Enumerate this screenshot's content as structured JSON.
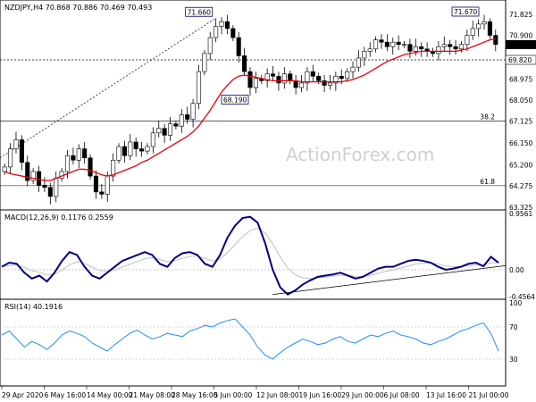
{
  "colors": {
    "background": "#ffffff",
    "candle_up": "#000000",
    "candle_down": "#000000",
    "sma": "#e8000b",
    "macd_main": "#000080",
    "macd_signal": "#c0c0c0",
    "rsi": "#1e90ff",
    "level_line": "#000000",
    "price_tag_bg": "#000000",
    "price_tag_text": "#ffffff",
    "rsi_level": "#aaaaaa"
  },
  "chart_data": [
    {
      "type": "candlestick",
      "title": "NZDJPY,H4  70.868 70.886 70.469 70.493",
      "ylim": [
        63.325,
        72.3
      ],
      "yticks": [
        "71.825",
        "70.900",
        "69.820",
        "68.975",
        "68.050",
        "67.125",
        "66.150",
        "65.200",
        "64.275",
        "63.325"
      ],
      "current_price": "70.493",
      "level_price": "69.820",
      "close": [
        65.1,
        65.9,
        66.3,
        65.3,
        64.5,
        64.9,
        64.3,
        64.2,
        63.8,
        64.6,
        64.9,
        65.6,
        65.4,
        65.9,
        65.5,
        64.7,
        64.0,
        63.9,
        64.7,
        65.4,
        66.0,
        65.6,
        66.2,
        65.9,
        65.8,
        66.0,
        66.6,
        66.8,
        66.5,
        67.0,
        66.9,
        67.4,
        67.2,
        67.9,
        69.3,
        70.1,
        70.8,
        71.3,
        71.5,
        71.2,
        70.8,
        70.0,
        69.3,
        68.6,
        69.0,
        68.9,
        69.2,
        69.1,
        68.8,
        69.2,
        68.9,
        68.6,
        68.8,
        69.3,
        69.1,
        68.9,
        68.7,
        68.8,
        69.1,
        69.0,
        69.3,
        69.5,
        69.9,
        70.2,
        70.3,
        70.7,
        70.6,
        70.4,
        70.6,
        70.5,
        70.5,
        70.2,
        70.4,
        70.3,
        70.2,
        70.1,
        70.4,
        70.5,
        70.4,
        70.3,
        70.5,
        70.9,
        71.2,
        71.4,
        71.5,
        70.9,
        70.5
      ],
      "sma": [
        64.9,
        64.8,
        64.75,
        64.7,
        64.65,
        64.6,
        64.55,
        64.5,
        64.5,
        64.6,
        64.7,
        64.8,
        64.9,
        65.0,
        65.0,
        64.95,
        64.85,
        64.75,
        64.7,
        64.75,
        64.85,
        64.95,
        65.05,
        65.15,
        65.3,
        65.4,
        65.55,
        65.7,
        65.85,
        66.0,
        66.15,
        66.3,
        66.45,
        66.65,
        66.9,
        67.25,
        67.6,
        68.0,
        68.4,
        68.7,
        68.95,
        69.1,
        69.15,
        69.1,
        69.05,
        69.0,
        68.95,
        68.9,
        68.9,
        68.9,
        68.9,
        68.9,
        68.85,
        68.85,
        68.85,
        68.85,
        68.85,
        68.85,
        68.85,
        68.85,
        68.9,
        68.95,
        69.05,
        69.15,
        69.3,
        69.45,
        69.6,
        69.75,
        69.85,
        69.95,
        70.05,
        70.1,
        70.15,
        70.2,
        70.2,
        70.2,
        70.2,
        70.2,
        70.2,
        70.2,
        70.25,
        70.3,
        70.4,
        70.5,
        70.6,
        70.7,
        70.75
      ],
      "annotations": [
        {
          "text": "71.660",
          "price": 71.66
        },
        {
          "text": "68.190",
          "price": 68.19
        },
        {
          "text": "71.670",
          "price": 71.67
        },
        {
          "text": "38.2",
          "price": 67.125
        },
        {
          "text": "61.8",
          "price": 64.275
        }
      ]
    },
    {
      "type": "line",
      "title": "MACD(12,26,9) 0.1176 0.2559",
      "ylim": [
        -0.4564,
        0.9561
      ],
      "yticks": [
        "0.9561",
        "0.00",
        "-0.4564"
      ],
      "series": [
        {
          "name": "MACD",
          "values": [
            0.05,
            0.12,
            0.1,
            -0.05,
            -0.15,
            -0.1,
            -0.2,
            -0.05,
            0.15,
            0.3,
            0.25,
            0.05,
            -0.1,
            -0.15,
            -0.05,
            0.05,
            0.15,
            0.2,
            0.25,
            0.3,
            0.25,
            0.1,
            0.05,
            0.2,
            0.28,
            0.3,
            0.25,
            0.1,
            0.05,
            0.25,
            0.55,
            0.75,
            0.88,
            0.9,
            0.8,
            0.45,
            0.0,
            -0.3,
            -0.42,
            -0.35,
            -0.25,
            -0.18,
            -0.12,
            -0.1,
            -0.08,
            -0.05,
            -0.1,
            -0.15,
            -0.12,
            -0.05,
            0.02,
            0.05,
            0.05,
            0.1,
            0.15,
            0.17,
            0.15,
            0.12,
            0.05,
            0.0,
            0.02,
            0.05,
            0.1,
            0.12,
            0.06,
            0.22,
            0.12
          ]
        }
      ],
      "trendline": [
        [
          36,
          -0.42
        ],
        [
          66,
          0.02
        ]
      ]
    },
    {
      "type": "line",
      "title": "RSI(14) 40.1916",
      "ylim": [
        0,
        100
      ],
      "yticks": [
        "100",
        "70",
        "30",
        "0"
      ],
      "series": [
        {
          "name": "RSI",
          "values": [
            60,
            65,
            55,
            45,
            52,
            48,
            42,
            50,
            60,
            65,
            62,
            58,
            50,
            45,
            40,
            48,
            55,
            62,
            66,
            60,
            55,
            58,
            62,
            60,
            58,
            65,
            68,
            72,
            70,
            75,
            78,
            80,
            70,
            60,
            45,
            35,
            30,
            38,
            45,
            50,
            55,
            52,
            48,
            50,
            55,
            58,
            52,
            50,
            55,
            60,
            58,
            62,
            65,
            60,
            58,
            55,
            50,
            48,
            52,
            55,
            60,
            65,
            68,
            72,
            75,
            62,
            40
          ]
        }
      ]
    }
  ],
  "xaxis": {
    "labels": [
      "29 Apr 2020",
      "6 May 16:00",
      "14 May 00:00",
      "21 May 08:00",
      "28 May 16:00",
      "5 Jun 00:00",
      "12 Jun 08:00",
      "19 Jun 16:00",
      "29 Jun 00:00",
      "6 Jul 08:00",
      "13 Jul 16:00",
      "21 Jul 00:00"
    ]
  },
  "watermark": "ActionForex.com"
}
